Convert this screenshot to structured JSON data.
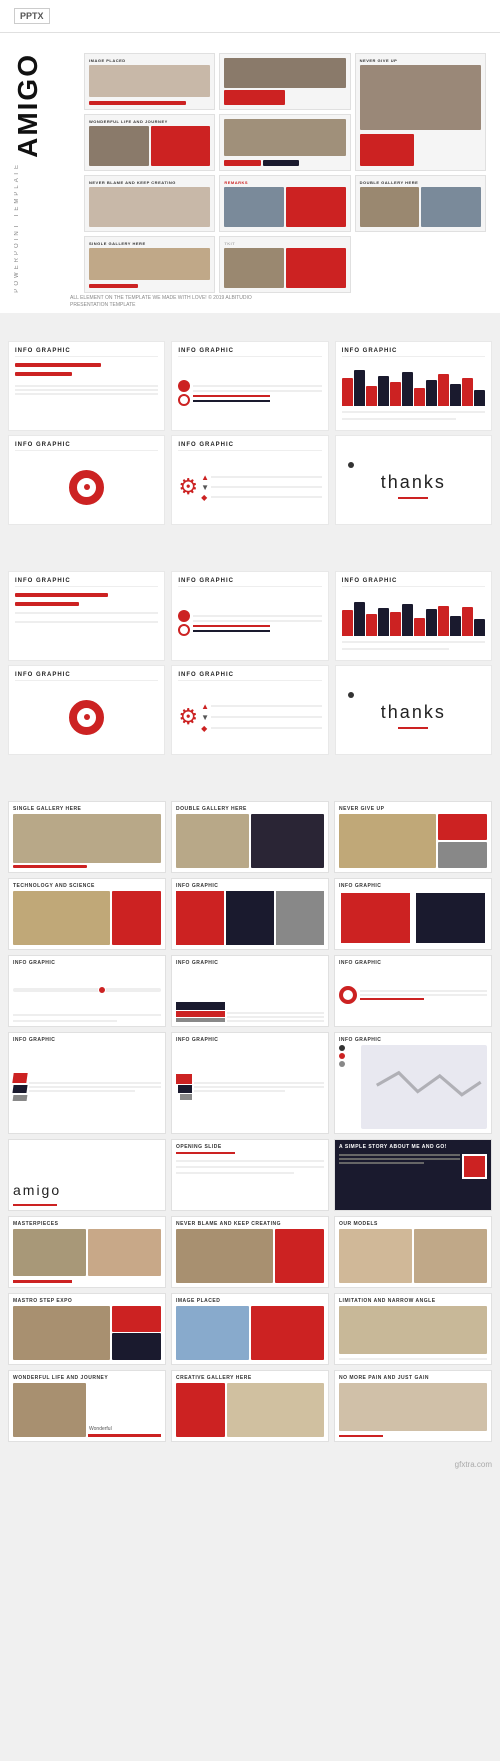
{
  "header": {
    "badge": "PPTX"
  },
  "hero": {
    "title": "AMIGO",
    "subtitle": "POWERPOINT TEMPLATE",
    "caption": "ALL ELEMENT ON THE TEMPLATE WE MADE WITH LOVE! © 2019 ALBITUDIO PRESENTATION TEMPLATE"
  },
  "infographic_section1": {
    "title": "INFO GRAPHIC",
    "cards": [
      {
        "type": "bars",
        "title": "INFO GRAPHIC"
      },
      {
        "type": "circle",
        "title": "INFO GRAPHIC"
      },
      {
        "type": "chart",
        "title": "INFO GRAPHIC"
      },
      {
        "type": "donut-ring",
        "title": "INFO GRAPHIC"
      },
      {
        "type": "gear",
        "title": "INFO GRAPHIC"
      },
      {
        "type": "thanks",
        "text": "thanks"
      }
    ]
  },
  "infographic_section2": {
    "cards": [
      {
        "type": "bars",
        "title": "INFO GRAPHIC"
      },
      {
        "type": "circle",
        "title": "INFO GRAPHIC"
      },
      {
        "type": "chart",
        "title": "INFO GRAPHIC"
      },
      {
        "type": "donut-ring",
        "title": "INFO GRAPHIC"
      },
      {
        "type": "gear",
        "title": "INFO GRAPHIC"
      },
      {
        "type": "thanks",
        "text": "thanks"
      }
    ]
  },
  "preview_section": {
    "slides": [
      {
        "type": "gallery",
        "title": "SINGLE GALLERY HERE"
      },
      {
        "type": "double-gallery",
        "title": "DOUBLE GALLERY HERE"
      },
      {
        "type": "never-give-up",
        "title": "NEVER GIVE UP"
      },
      {
        "type": "tech-info",
        "title": "TECHNOLOGY AND SCIENCE"
      },
      {
        "type": "info-bars",
        "title": "INFO GRAPHIC"
      },
      {
        "type": "info-bars2",
        "title": "INFO GRAPHIC"
      },
      {
        "type": "info-progress",
        "title": "INFO GRAPHIC"
      },
      {
        "type": "info-stack",
        "title": "INFO GRAPHIC"
      },
      {
        "type": "info-circle2",
        "title": "INFO GRAPHIC"
      },
      {
        "type": "info-iso",
        "title": "INFO GRAPHIC"
      },
      {
        "type": "info-iso2",
        "title": "INFO GRAPHIC"
      },
      {
        "type": "info-map",
        "title": "INFO GRAPHIC"
      },
      {
        "type": "amigo-open",
        "title": "amigo"
      },
      {
        "type": "opening-slide",
        "title": "OPENING SLIDE"
      },
      {
        "type": "story",
        "title": "A SIMPLE STORY ABOUT ME AND GO!"
      },
      {
        "type": "masterpieces",
        "title": "MASTERPIECES"
      },
      {
        "type": "never-blame",
        "title": "NEVER BLAME AND KEEP CREATING"
      },
      {
        "type": "our-models",
        "title": "OUR MODELS"
      },
      {
        "type": "mastro",
        "title": "MASTRO STEP EXPO"
      },
      {
        "type": "image-placed",
        "title": "IMAGE PLACED"
      },
      {
        "type": "limitation",
        "title": "LIMITATION AND NARROW ANGLE"
      },
      {
        "type": "wonderful",
        "title": "WONDERFUL LIFE AND JOURNEY"
      },
      {
        "type": "creative-gallery",
        "title": "CREATIVE GALLERY HERE"
      },
      {
        "type": "no-more-pain",
        "title": "NO MORE PAIN AND JUST GAIN"
      }
    ]
  },
  "thanks_text": "thanks",
  "watermark": "gfxtra.com"
}
